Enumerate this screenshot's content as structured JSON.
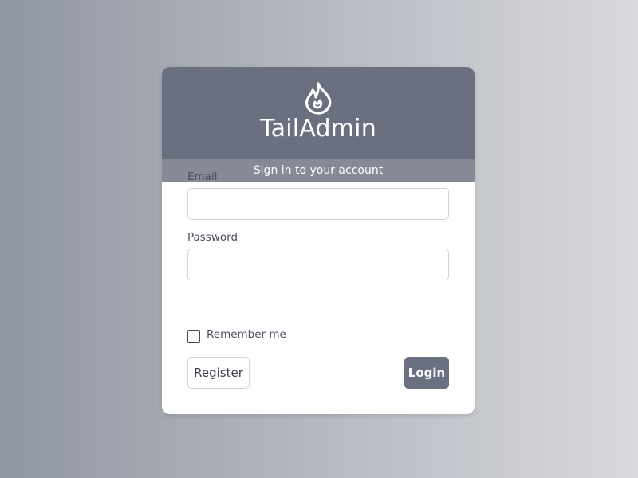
{
  "brand": {
    "name": "TailAdmin",
    "subtitle": "Sign in to your account",
    "logo_icon": "flame-icon"
  },
  "form": {
    "email_label": "Email",
    "email_value": "",
    "password_label": "Password",
    "password_value": "",
    "remember_label": "Remember me",
    "remember_checked": false
  },
  "actions": {
    "register_label": "Register",
    "login_label": "Login"
  },
  "colors": {
    "header": "#6b7080",
    "subheader": "#868a96",
    "primary_button": "#6b7080"
  }
}
